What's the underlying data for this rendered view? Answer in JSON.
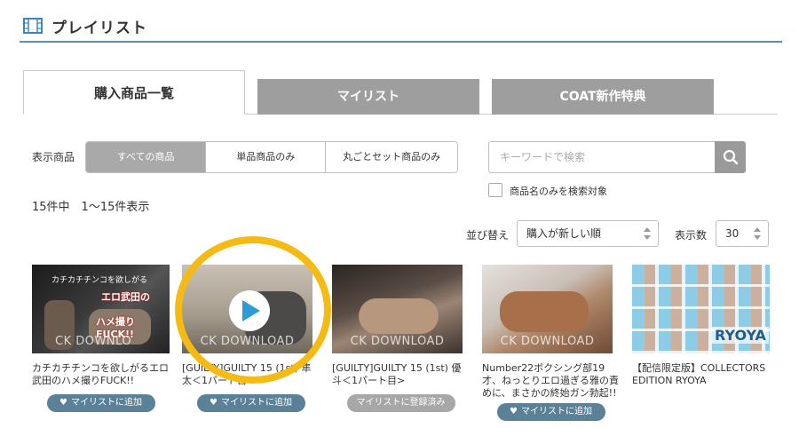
{
  "header": {
    "title": "プレイリスト",
    "icon": "film-icon"
  },
  "tabs": [
    {
      "label": "購入商品一覧",
      "active": true
    },
    {
      "label": "マイリスト",
      "active": false
    },
    {
      "label": "COAT新作特典",
      "active": false
    }
  ],
  "filter": {
    "label": "表示商品",
    "options": [
      "すべての商品",
      "単品商品のみ",
      "丸ごとセット商品のみ"
    ],
    "selected": "すべての商品"
  },
  "search": {
    "placeholder": "キーワードで検索",
    "value": "",
    "title_only_label": "商品名のみを検索対象",
    "title_only_checked": false
  },
  "result_count": "15件中　1～15件表示",
  "sort": {
    "label": "並び替え",
    "value": "購入が新しい順"
  },
  "per_page": {
    "label": "表示数",
    "value": "30"
  },
  "products": [
    {
      "title": "カチカチチンコを欲しがるエロ武田のハメ撮りFUCK!!",
      "button": "マイリストに追加",
      "in_mylist": false,
      "thumb_caption_1": "カチカチチンコを欲しがる",
      "thumb_caption_2": "エロ武田の",
      "thumb_caption_3": "ハメ撮りFUCK!!",
      "watermark": "CK DOWNLO"
    },
    {
      "title": "[GUILTY]GUILTY 15 (1st) 隼太＜1パート目>",
      "button": "マイリストに追加",
      "in_mylist": false,
      "watermark": "CK DOWNLOAD"
    },
    {
      "title": "[GUILTY]GUILTY 15 (1st) 優斗＜1パート目>",
      "button": "マイリストに登録済み",
      "in_mylist": true,
      "watermark": "CK DOWNLOAD"
    },
    {
      "title": "Number22ボクシング部19才、ねっとりエロ過ぎる雅の責めに、まさかの終始ガン勃起!!",
      "button": "マイリストに追加",
      "in_mylist": false,
      "watermark": "CK DOWNLOAD"
    },
    {
      "title": "【配信限定版】COLLECTORS EDITION RYOYA",
      "button": null,
      "in_mylist": false,
      "thumb_text": "RYOYA"
    }
  ],
  "colors": {
    "accent_line": "#5a8fb3",
    "tab_inactive": "#9e9e9e",
    "pill_add": "#5b8199",
    "pill_done": "#a7a7a7",
    "highlight_ring": "#f5bb14",
    "play_icon": "#2e9bd6"
  }
}
